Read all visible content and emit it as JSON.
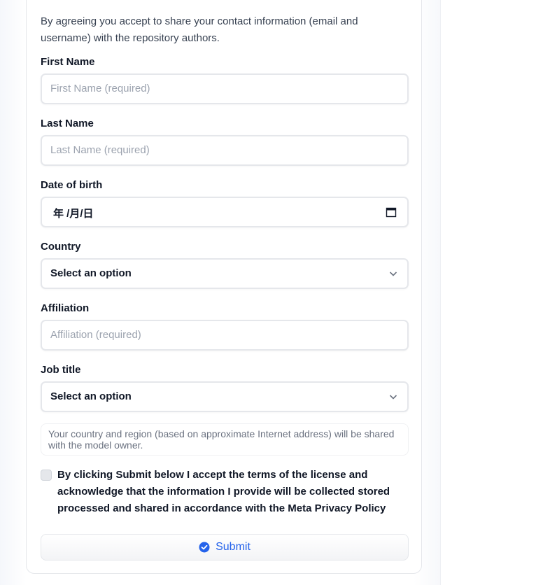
{
  "form": {
    "intro_text": "By agreeing you accept to share your contact information (email and username) with the repository authors.",
    "fields": {
      "first_name": {
        "label": "First Name",
        "placeholder": "First Name (required)"
      },
      "last_name": {
        "label": "Last Name",
        "placeholder": "Last Name (required)"
      },
      "dob": {
        "label": "Date of birth",
        "value": "年 /月/日"
      },
      "country": {
        "label": "Country",
        "value": "Select an option"
      },
      "affiliation": {
        "label": "Affiliation",
        "placeholder": "Affiliation (required)"
      },
      "job_title": {
        "label": "Job title",
        "value": "Select an option"
      }
    },
    "notice": "Your country and region (based on approximate Internet address) will be shared with the model owner.",
    "terms": "By clicking Submit below I accept the terms of the license and acknowledge that the information I provide will be collected stored processed and shared in accordance with the Meta Privacy Policy",
    "submit_label": "Submit",
    "icons": {
      "chevron": "chevron-down-icon",
      "calendar": "calendar-icon",
      "submit": "check-circle-icon"
    },
    "colors": {
      "accent": "#2563eb",
      "border": "#e5e7eb"
    }
  }
}
